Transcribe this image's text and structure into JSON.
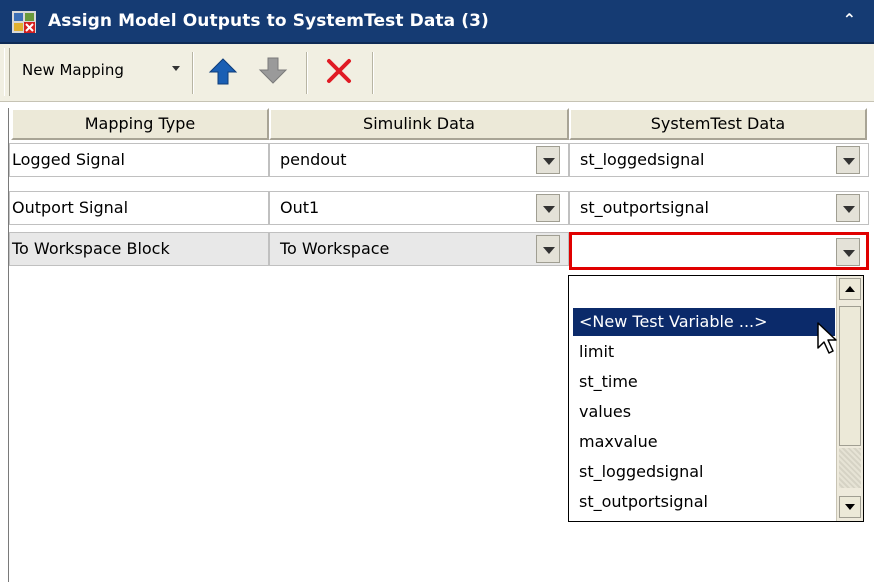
{
  "window": {
    "title": "Assign Model Outputs to SystemTest Data (3)",
    "collapse_glyph": "⌃"
  },
  "toolbar": {
    "new_mapping_label": "New Mapping",
    "icons": [
      "move-up-icon",
      "move-down-icon",
      "delete-icon"
    ],
    "colors": {
      "up_arrow": "#1a5fb4",
      "down_arrow": "#9a9a9a",
      "delete": "#e01b24"
    }
  },
  "table": {
    "headers": [
      "Mapping Type",
      "Simulink Data",
      "SystemTest Data"
    ],
    "rows": [
      {
        "mapping_type": "Logged Signal",
        "simulink_data": "pendout",
        "systemtest_data": "st_loggedsignal"
      },
      {
        "mapping_type": "Outport Signal",
        "simulink_data": "Out1",
        "systemtest_data": "st_outportsignal"
      },
      {
        "mapping_type": "To Workspace Block",
        "simulink_data": "To Workspace",
        "systemtest_data": ""
      }
    ]
  },
  "dropdown": {
    "options": [
      "",
      "<New Test Variable ...>",
      "limit",
      "st_time",
      "values",
      "maxvalue",
      "st_loggedsignal",
      "st_outportsignal"
    ],
    "highlighted": "<New Test Variable ...>"
  }
}
